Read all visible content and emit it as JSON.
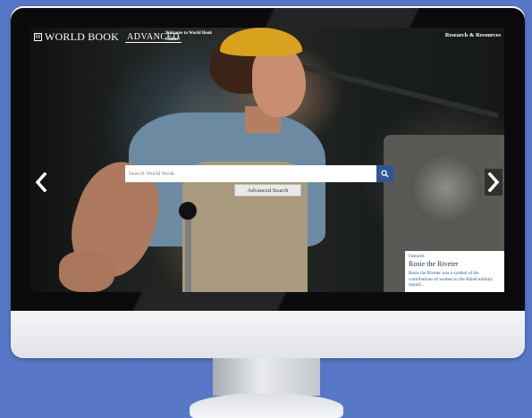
{
  "header": {
    "logo_mark": "W",
    "logo_text": "WORLD BOOK",
    "logo_edition": "ADVANCED",
    "welcome": "Welcome to World Book Online!",
    "research_link": "Research & Resources"
  },
  "search": {
    "placeholder": "Search World Book",
    "advanced_label": "Advanced Search"
  },
  "featured": {
    "label": "Featured",
    "title": "Rosie the Riveter",
    "description": "Rosie the Riveter was a symbol of the contributions of women to the Allied military manuf..."
  },
  "icons": {
    "search": "search-icon",
    "prev": "chevron-left-icon",
    "next": "chevron-right-icon"
  },
  "colors": {
    "page_background": "#5877c6",
    "accent_blue": "#2f5797"
  }
}
